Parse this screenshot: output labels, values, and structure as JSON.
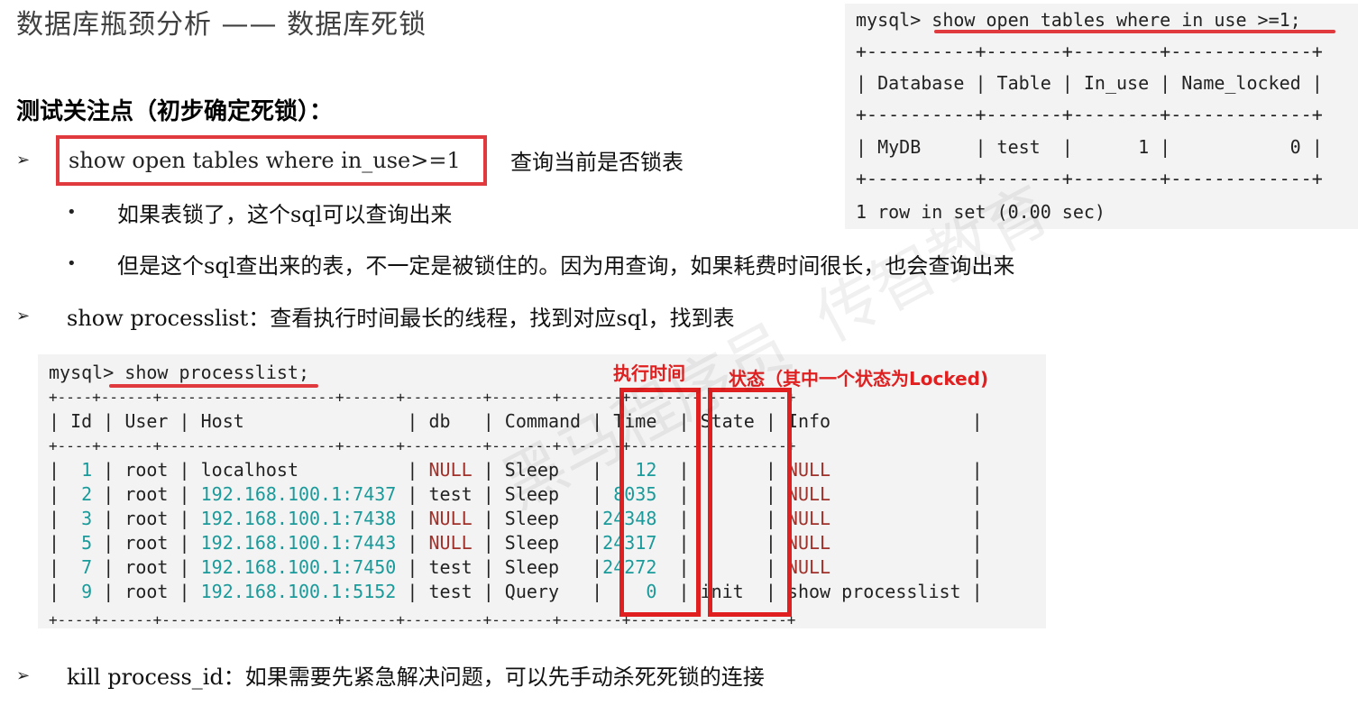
{
  "title": "数据库瓶颈分析 —— 数据库死锁",
  "subtitle": "测试关注点（初步确定死锁）：",
  "items": [
    {
      "arrow": "➢",
      "code": "show open tables where in_use>=1",
      "desc": "查询当前是否锁表",
      "bullets": [
        {
          "mark": "•",
          "text": "如果表锁了，这个sql可以查询出来"
        },
        {
          "mark": "•",
          "text": "但是这个sql查出来的表，不一定是被锁住的。因为用查询，如果耗费时间很长，也会查询出来"
        }
      ]
    },
    {
      "arrow": "➢",
      "text": "show processlist：查看执行时间最长的线程，找到对应sql，找到表"
    },
    {
      "arrow": "➢",
      "text": "kill process_id：如果需要先紧急解决问题，可以先手动杀死死锁的连接"
    }
  ],
  "term1": {
    "prompt": "mysql>",
    "command": "show open tables where in_use >=1;",
    "border": "+----------+-------+--------+-------------+",
    "header": "| Database | Table | In_use | Name_locked |",
    "row": "| MyDB     | test  |      1 |           0 |",
    "footer": "1 row in set (0.00 sec)"
  },
  "term2": {
    "prompt": "mysql>",
    "command": "show processlist;",
    "border": "+----+------+--------------------+------+---------+-------+-------+------------------+",
    "columns": [
      "Id",
      "User",
      "Host",
      "db",
      "Command",
      "Time",
      "State",
      "Info"
    ],
    "rows": [
      {
        "id": "1",
        "user": "root",
        "host": "localhost",
        "db": "NULL",
        "command": "Sleep",
        "time": "12",
        "state": "",
        "info": "NULL"
      },
      {
        "id": "2",
        "user": "root",
        "host": "192.168.100.1:7437",
        "db": "test",
        "command": "Sleep",
        "time": "8035",
        "state": "",
        "info": "NULL"
      },
      {
        "id": "3",
        "user": "root",
        "host": "192.168.100.1:7438",
        "db": "NULL",
        "command": "Sleep",
        "time": "24348",
        "state": "",
        "info": "NULL"
      },
      {
        "id": "5",
        "user": "root",
        "host": "192.168.100.1:7443",
        "db": "NULL",
        "command": "Sleep",
        "time": "24317",
        "state": "",
        "info": "NULL"
      },
      {
        "id": "7",
        "user": "root",
        "host": "192.168.100.1:7450",
        "db": "test",
        "command": "Sleep",
        "time": "24272",
        "state": "",
        "info": "NULL"
      },
      {
        "id": "9",
        "user": "root",
        "host": "192.168.100.1:5152",
        "db": "test",
        "command": "Query",
        "time": "0",
        "state": "init",
        "info": "show processlist"
      }
    ],
    "annotation_time": "执行时间",
    "annotation_state": "状态（其中一个状态为Locked)"
  },
  "watermark": "黑马程序员  传智教育",
  "colors": {
    "accent": "#e0393e",
    "null": "#a0302a",
    "numbers": "#1a9a9a",
    "terminal_bg": "#f3f3f3"
  }
}
